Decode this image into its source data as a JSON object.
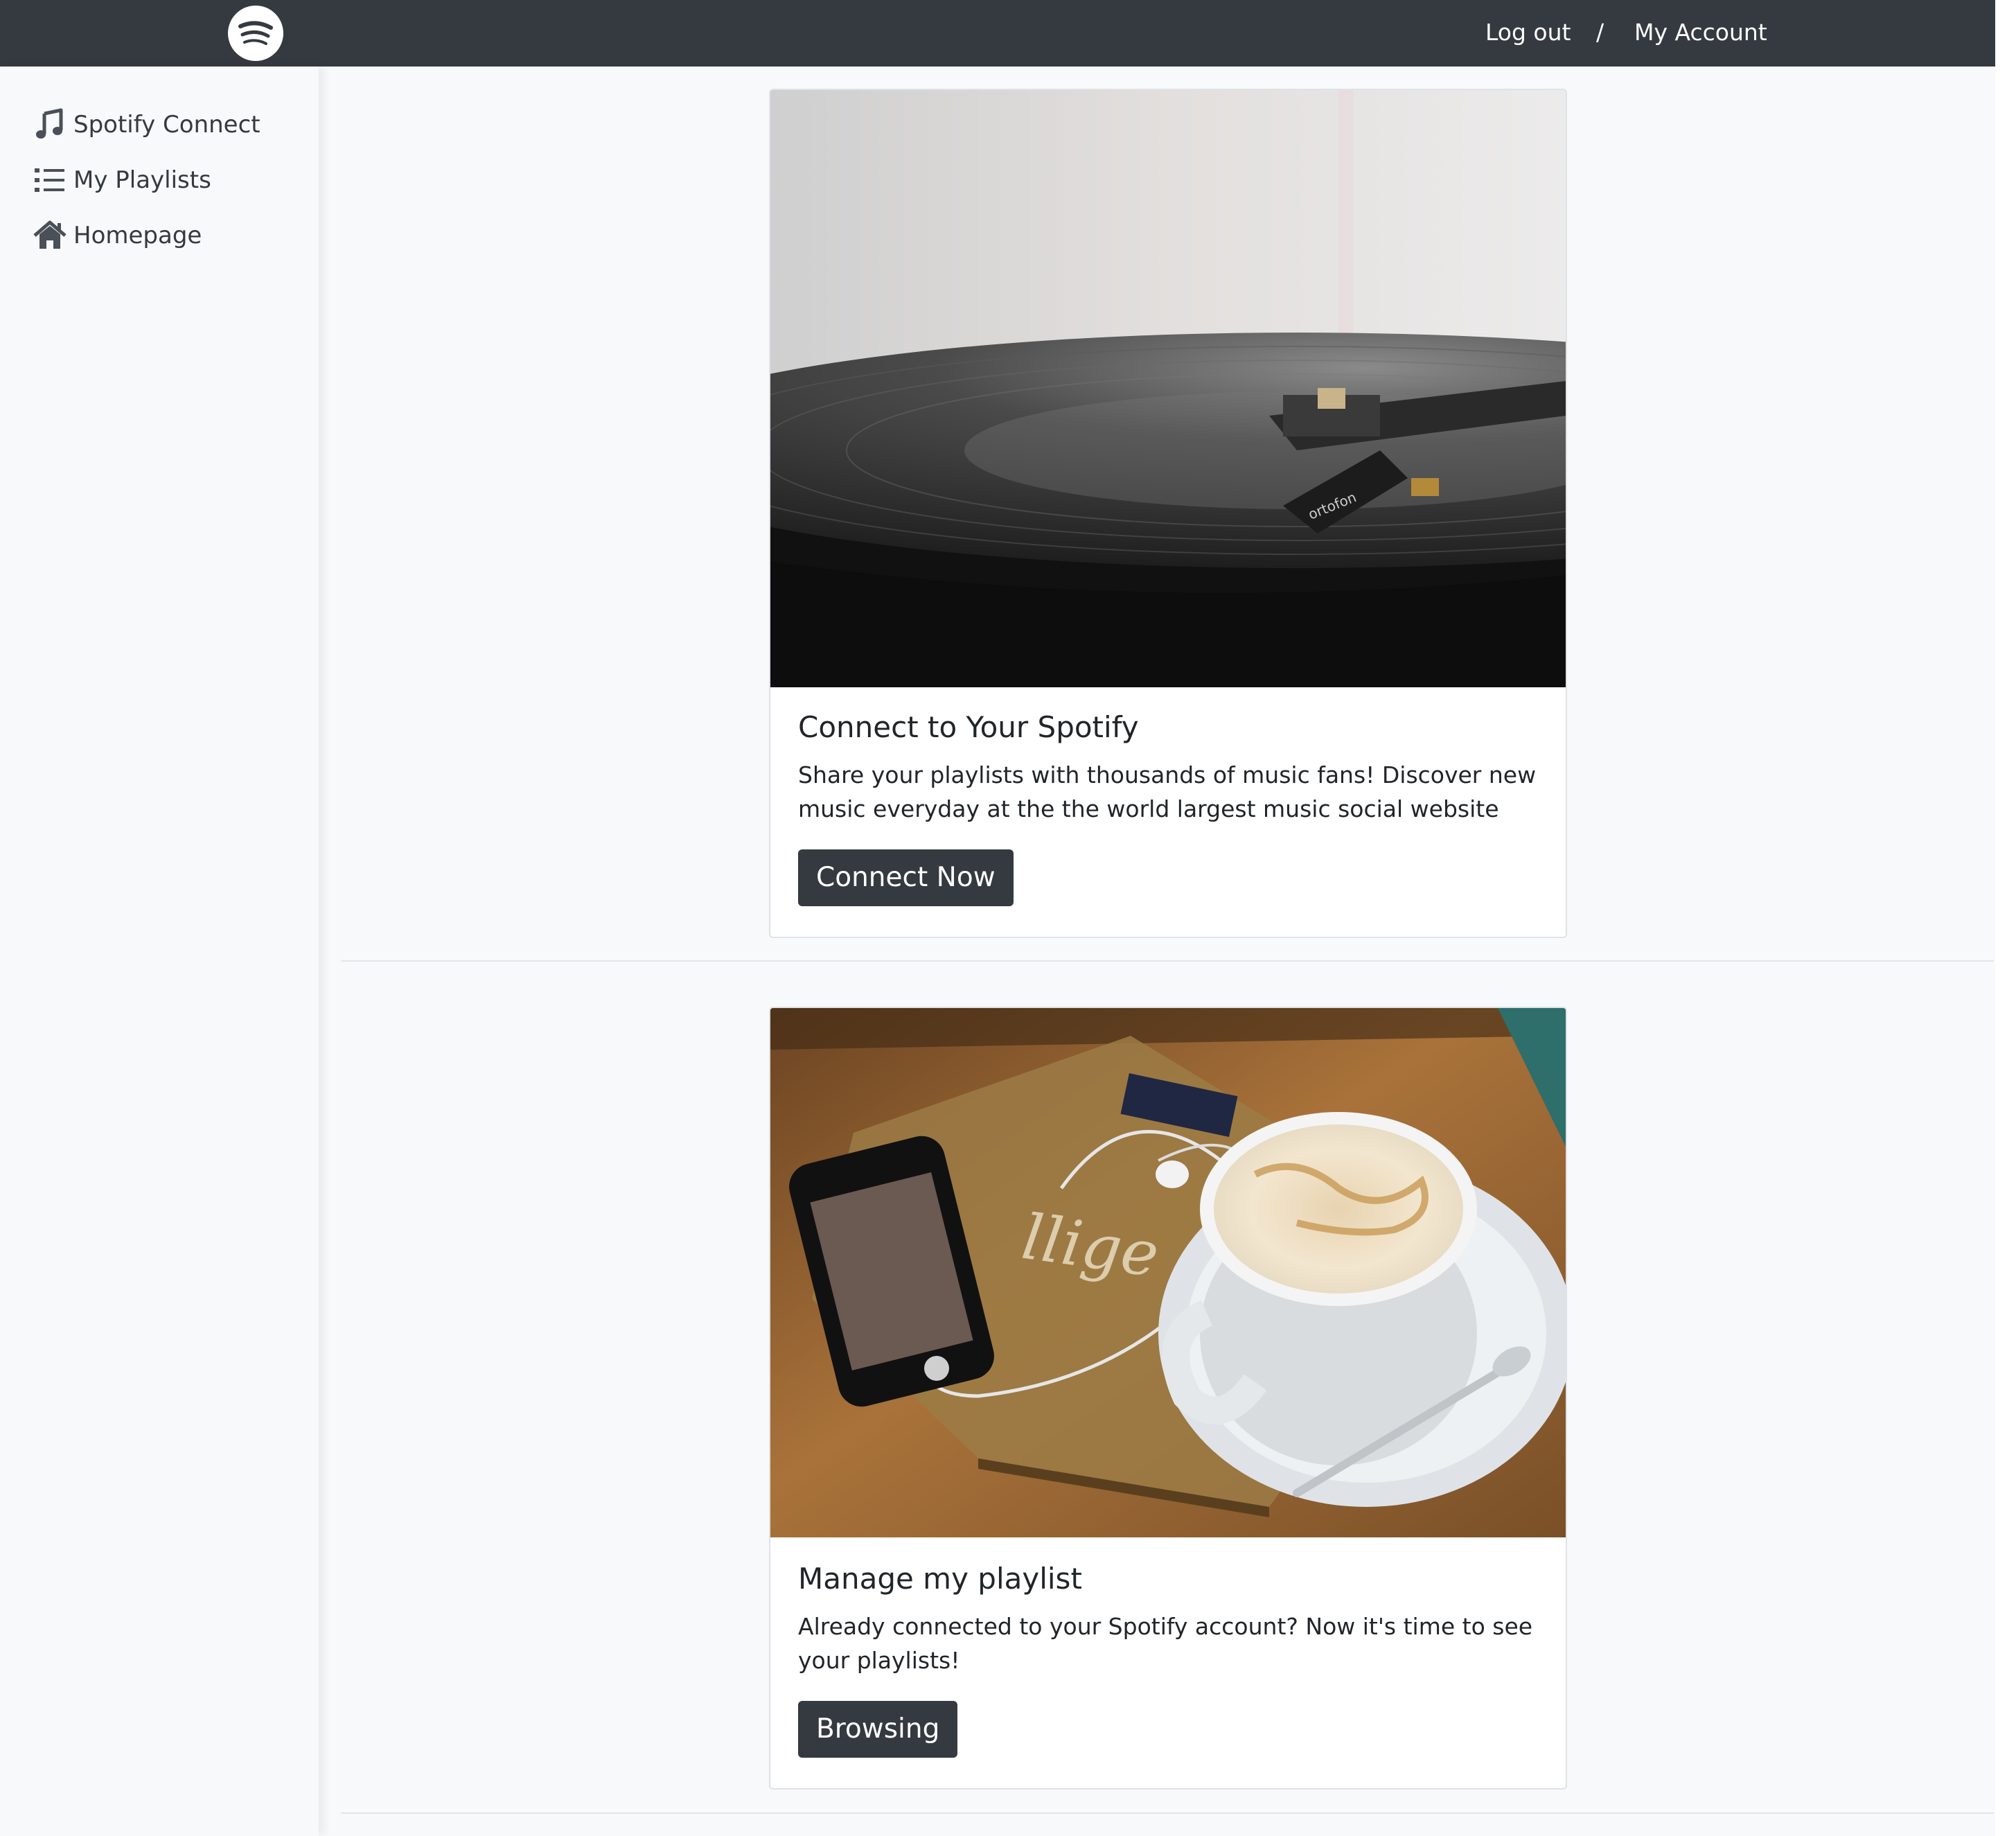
{
  "navbar": {
    "brand_icon": "spotify-logo-icon",
    "logout_label": "Log out",
    "separator": "/",
    "account_label": "My Account"
  },
  "sidebar": {
    "items": [
      {
        "label": "Spotify Connect",
        "icon": "music-note-icon"
      },
      {
        "label": "My Playlists",
        "icon": "list-icon"
      },
      {
        "label": "Homepage",
        "icon": "home-icon"
      }
    ]
  },
  "cards": [
    {
      "image": "turntable-record-photo",
      "title": "Connect to Your Spotify",
      "text": "Share your playlists with thousands of music fans! Discover new music everyday at the the world largest music social website",
      "button_label": "Connect Now"
    },
    {
      "image": "coffee-phone-earphones-photo",
      "title": "Manage my playlist",
      "text": "Already connected to your Spotify account? Now it's time to see your playlists!",
      "button_label": "Browsing"
    }
  ],
  "colors": {
    "navbar_bg": "#343a40",
    "button_bg": "#343a40",
    "page_bg": "#f8f9fa",
    "card_bg": "#ffffff"
  }
}
